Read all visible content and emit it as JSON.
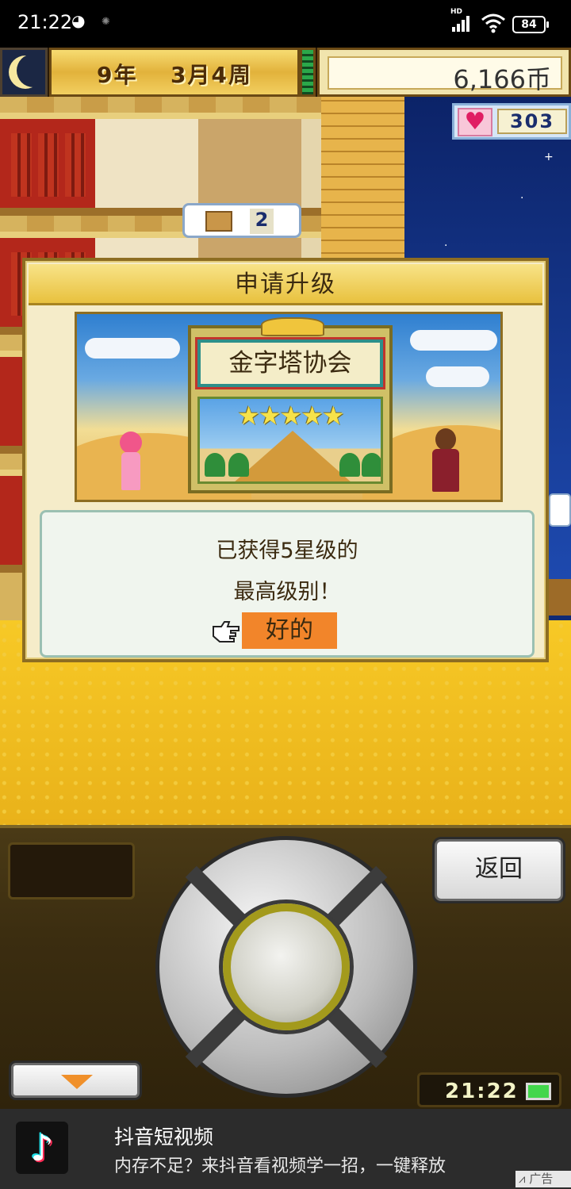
{
  "status_bar": {
    "time": "21:22",
    "network": "HD",
    "battery": "84"
  },
  "header": {
    "year": "9",
    "year_unit": "年",
    "month": "3",
    "month_unit": "月",
    "week": "4",
    "week_unit": "周",
    "money": "6,166币",
    "love_points": "303"
  },
  "world": {
    "room_badge_number": "2"
  },
  "dialog": {
    "title": "申请升级",
    "association_name": "金字塔协会",
    "star_rating": 5,
    "message_line1": "已获得5星级的",
    "message_line2": "最高级别！",
    "ok_label": "好的"
  },
  "controller": {
    "back_label": "返回",
    "clock": "21:22"
  },
  "ad": {
    "title": "抖音短视频",
    "description": "内存不足？来抖音看视频学一招，一键释放",
    "tag": "广告"
  },
  "colors": {
    "ok_highlight": "#f2852a",
    "dialog_title_bg": "#e8c13e",
    "heart": "#e01e63"
  }
}
